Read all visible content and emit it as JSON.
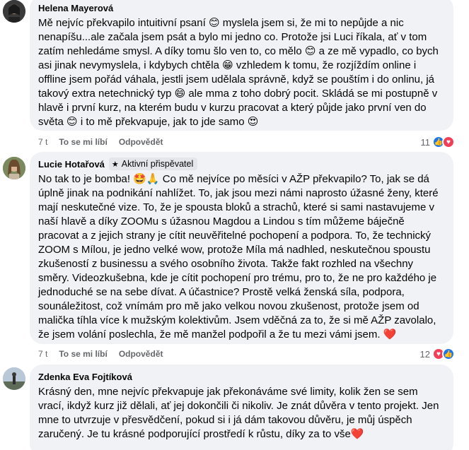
{
  "comments": [
    {
      "author": "Helena Mayerová",
      "badge": "",
      "text": "Mě nejvíc překvapilo intuitivní psaní 😊 myslela jsem si, že mi to nepůjde a nic nenapíšu...ale začala jsem psát a bylo mi jedno co. Protože jsi Luci říkala, ať v tom zatím nehledáme smysl. A díky tomu šlo ven to, co mělo 😊 a ze mě vypadlo, co bych asi jinak nevymyslela, i kdybych chtěla 😁 vzhledem k tomu, že rozjíždím online i offline jsem pořád váhala, jestli jsem udělala správně, když se pouštím i do onlinu, já takový extra netechnický typ 😄 ale mma z toho dobrý pocit. Skládá se mi postupně v hlavě i první kurz, na kterém budu v kurzu pracovat a který půjde jako první ven do světa 😊 i to mě překvapuje, jak to jde samo 😍",
      "time": "7 t",
      "like_label": "To se mi líbí",
      "reply_label": "Odpovědět",
      "reaction_count": "11"
    },
    {
      "author": "Lucie Hotařová",
      "badge": "Aktivní přispěvatel",
      "text": "No tak to je bomba! 🤩🙏 Co mě nejvíce po měsíci v AŽP překvapilo? To, jak se dá úplně jinak na podnikání nahlížet. To, jak jsou mezi námi naprosto úžasné ženy, které mají neskutečné vize. To, že je spousta bloků a strachů, které si sami nastavujeme v naší hlavě a díky ZOOMu s úžasnou Magdou a Lindou s tím můžeme báječně pracovat a z jejich strany je cítit neuvěřitelné pochopení a podpora. To, že technický ZOOM s Mílou, je jedno velké wow, protože Míla má nadhled, neskutečnou spoustu zkušeností z businessu a svého osobního života. Takže fakt rozhled na všechny směry. Videozkušebna, kde je cítit pochopení pro trému, pro to, že ne pro každého je jednoduché se na sebe dívat. A účastnice? Prostě velká ženská síla, podpora, sounáležitost, což vnímám pro mě jako velkou novou zkušenost, protože jsem od malička tíhla více k mužským kolektivům. Jsem vděčná za to, že si mě AŽP zavolalo, že jsem volání poslechla, že mě manžel podpořil a že tu mezi vámi jsem. ❤️",
      "time": "7 t",
      "like_label": "To se mi líbí",
      "reply_label": "Odpovědět",
      "reaction_count": "12"
    },
    {
      "author": "Zdenka Eva Fojtíková",
      "badge": "",
      "text": "Krásný den, mne nejvíc překvapuje jak překonáváme své limity, kolik žen se sem vrací, ikdyž kurz již dělali, ať jej dokončili či nikoliv. Je znát důvěra v tento projekt. Jen mne to utvrzuje v přesvědčení, pokud si i já dám takovou důvěru, je můj úspěch zaručený. Je tu krásné podporující prostředí k růstu, díky za to vše❤️",
      "time": "",
      "like_label": "",
      "reply_label": "",
      "reaction_count": ""
    }
  ],
  "colors": {
    "bubble": "#f0f2f5",
    "secondary_text": "#65676b",
    "like_blue": "#1877f2",
    "love_red": "#f33e58"
  },
  "icons": [
    "thumbs-up-icon",
    "heart-icon",
    "star-icon"
  ]
}
